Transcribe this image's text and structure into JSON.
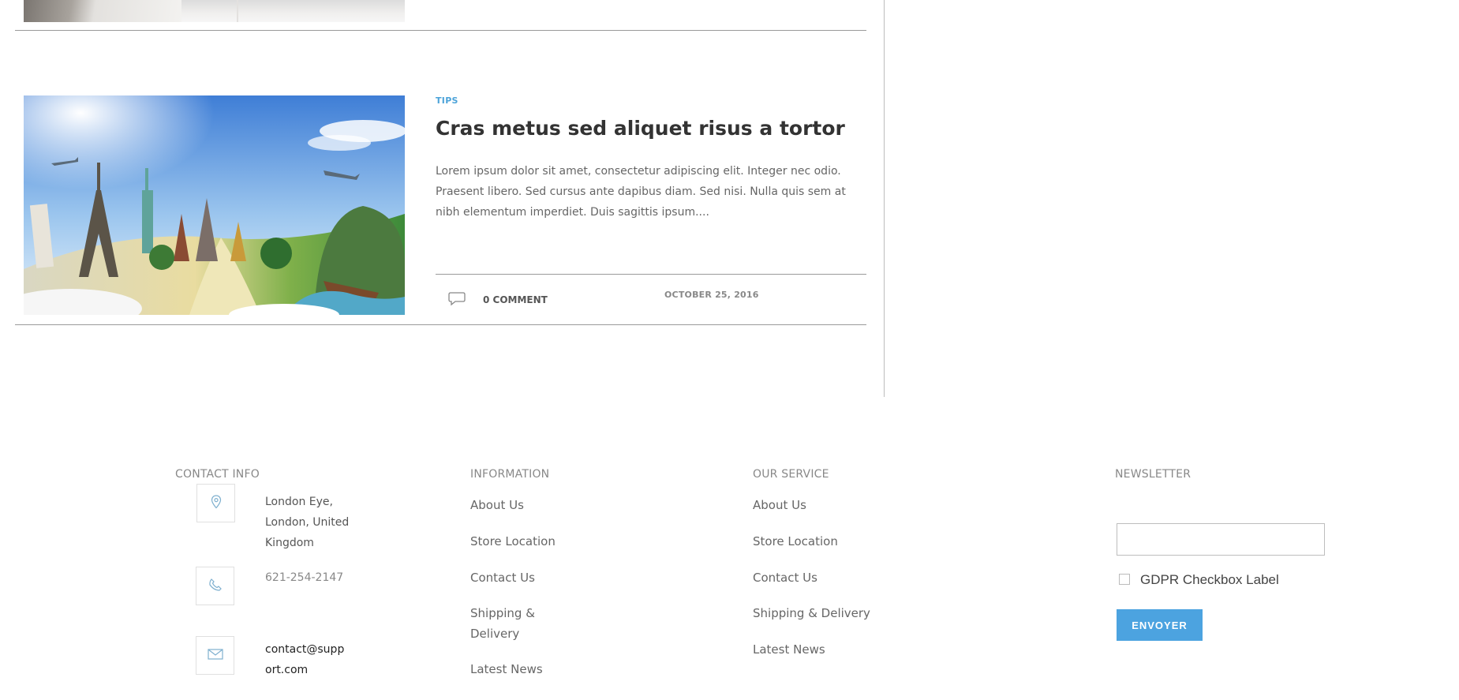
{
  "post": {
    "category": "TIPS",
    "title": "Cras metus sed aliquet risus a tortor",
    "excerpt": "Lorem ipsum dolor sit amet, consectetur adipiscing elit. Integer nec odio. Praesent libero. Sed cursus ante dapibus diam. Sed nisi. Nulla quis sem at nibh elementum imperdiet. Duis sagittis ipsum....",
    "comments": "0 COMMENT",
    "date": "OCTOBER 25, 2016",
    "image_icon": "travel-landmarks-image"
  },
  "footer": {
    "contact": {
      "heading": "CONTACT INFO",
      "address_lines": [
        "London Eye,",
        "London, United",
        "Kingdom"
      ],
      "phone": "621-254-2147",
      "email_lines": [
        "contact@supp",
        "ort.com"
      ],
      "icons": [
        "location-pin-icon",
        "phone-icon",
        "mail-icon"
      ]
    },
    "information": {
      "heading": "INFORMATION",
      "links": [
        "About Us",
        "Store Location",
        "Contact Us",
        "Shipping &",
        "Delivery",
        "Latest News"
      ]
    },
    "service": {
      "heading": "OUR SERVICE",
      "links": [
        "About Us",
        "Store Location",
        "Contact Us",
        "Shipping & Delivery",
        "Latest News"
      ]
    },
    "newsletter": {
      "heading": "NEWSLETTER",
      "input_value": "",
      "gdpr_label": "GDPR Checkbox Label",
      "button": "ENVOYER"
    }
  },
  "colors": {
    "accent": "#4ca3e0",
    "category": "#4ca3d9",
    "divider": "#9a9a9a",
    "icon": "#7fb0cf"
  }
}
